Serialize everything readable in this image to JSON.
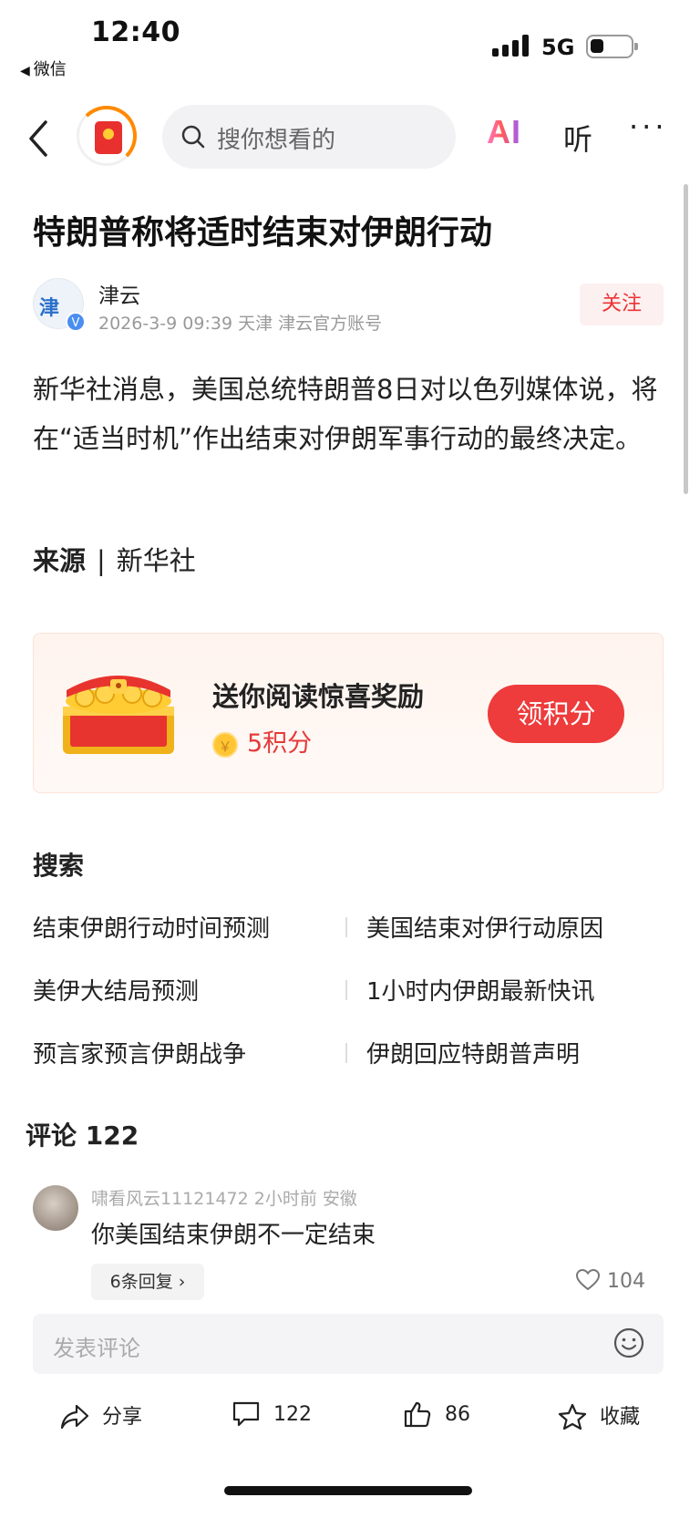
{
  "status_bar": {
    "time": "12:40",
    "back_app": "微信",
    "network": "5G"
  },
  "nav": {
    "search_placeholder": "搜你想看的",
    "ai_label": "AI",
    "listen_label": "听",
    "more_label": "···"
  },
  "article": {
    "title": "特朗普称将适时结束对伊朗行动",
    "author": {
      "name": "津云",
      "avatar_text": "津",
      "verified_mark": "V",
      "meta": "2026-3-9  09:39  天津  津云官方账号",
      "follow_label": "关注"
    },
    "body": "新华社消息，美国总统特朗普8日对以色列媒体说，将在“适当时机”作出结束对伊朗军事行动的最终决定。",
    "source_label": "来源",
    "source_sep": "|",
    "source_name": "新华社"
  },
  "reward": {
    "title": "送你阅读惊喜奖励",
    "coin_symbol": "￥",
    "points": "5积分",
    "claim_label": "领积分"
  },
  "search_section": {
    "title": "搜索",
    "suggestions": [
      "结束伊朗行动时间预测",
      "美国结束对伊行动原因",
      "美伊大结局预测",
      "1小时内伊朗最新快讯",
      "预言家预言伊朗战争",
      "伊朗回应特朗普声明"
    ]
  },
  "comments": {
    "title": "评论 122",
    "items": [
      {
        "user_line": "啸看风云11121472  2小时前  安徽",
        "text": "你美国结束伊朗不一定结束",
        "replies": "6条回复 ›",
        "likes": "104"
      }
    ],
    "input_placeholder": "发表评论"
  },
  "toolbar": {
    "share": "分享",
    "comments": "122",
    "likes": "86",
    "favorite": "收藏"
  },
  "colors": {
    "accent_red": "#ee3b3b",
    "follow_text": "#e33333",
    "points_red": "#e53a3a"
  }
}
